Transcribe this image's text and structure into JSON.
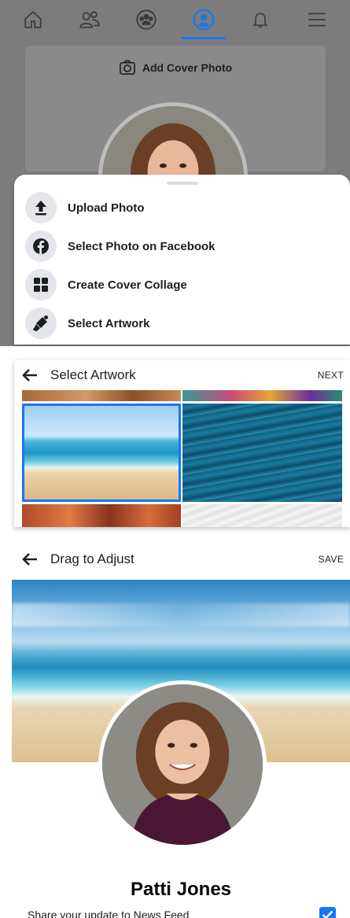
{
  "panel1": {
    "nav_icons": [
      "home-icon",
      "friends-icon",
      "groups-icon",
      "profile-icon",
      "bell-icon",
      "menu-icon"
    ],
    "active_nav": "profile-icon",
    "add_cover_label": "Add Cover Photo",
    "sheet_items": [
      {
        "label": "Upload Photo",
        "icon": "upload-icon"
      },
      {
        "label": "Select Photo on Facebook",
        "icon": "facebook-icon"
      },
      {
        "label": "Create Cover Collage",
        "icon": "collage-icon"
      },
      {
        "label": "Select Artwork",
        "icon": "paintbrush-icon"
      }
    ]
  },
  "panel2": {
    "title": "Select Artwork",
    "action": "NEXT",
    "selected_thumb": "beach"
  },
  "panel3": {
    "title": "Drag to Adjust",
    "action": "SAVE",
    "name": "Patti Jones",
    "share_label": "Share your update to News Feed",
    "share_checked": true
  },
  "colors": {
    "accent": "#1877f2",
    "dim_overlay": "#7c7c7c"
  }
}
